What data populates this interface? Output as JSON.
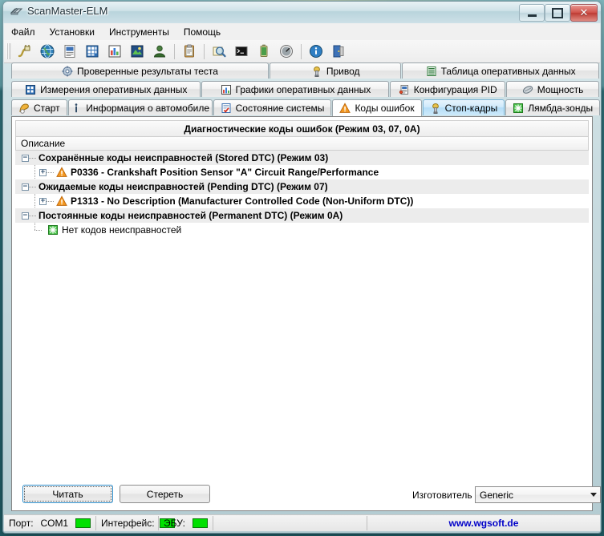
{
  "window": {
    "title": "ScanMaster-ELM",
    "icon": "chip-icon",
    "buttons": {
      "minimize": "minimize-icon",
      "maximize": "maximize-icon",
      "close": "✕"
    }
  },
  "menu": {
    "items": [
      {
        "label": "Файл",
        "name": "menu-file"
      },
      {
        "label": "Установки",
        "name": "menu-settings"
      },
      {
        "label": "Инструменты",
        "name": "menu-tools"
      },
      {
        "label": "Помощь",
        "name": "menu-help"
      }
    ]
  },
  "toolbar": {
    "buttons": [
      {
        "name": "connect-icon"
      },
      {
        "name": "globe-icon"
      },
      {
        "name": "report-icon"
      },
      {
        "name": "grid-icon"
      },
      {
        "name": "chart-icon"
      },
      {
        "name": "image-icon"
      },
      {
        "name": "user-icon"
      },
      {
        "name": "clipboard-icon"
      },
      {
        "name": "search-icon"
      },
      {
        "name": "terminal-icon"
      },
      {
        "name": "battery-icon"
      },
      {
        "name": "gauge-icon"
      },
      {
        "name": "info-icon"
      },
      {
        "name": "exit-icon"
      }
    ]
  },
  "tabs": {
    "row1": [
      {
        "label": "Проверенные результаты теста",
        "icon": "gear-icon",
        "selected": false
      },
      {
        "label": "Привод",
        "icon": "actuator-icon",
        "selected": false
      },
      {
        "label": "Таблица оперативных данных",
        "icon": "table-icon",
        "selected": false
      }
    ],
    "row2": [
      {
        "label": "Измерения оперативных данных",
        "icon": "measurements-icon",
        "selected": false
      },
      {
        "label": "Графики оперативных данных",
        "icon": "graph-icon",
        "selected": false
      },
      {
        "label": "Конфигурация PID",
        "icon": "pid-config-icon",
        "selected": false
      },
      {
        "label": "Мощность",
        "icon": "power-icon",
        "selected": false
      }
    ],
    "row3": [
      {
        "label": "Старт",
        "icon": "start-icon",
        "selected": false
      },
      {
        "label": "Информация о автомобиле",
        "icon": "vehicle-info-icon",
        "selected": false
      },
      {
        "label": "Состояние системы",
        "icon": "system-status-icon",
        "selected": false
      },
      {
        "label": "Коды ошибок",
        "icon": "warning-icon",
        "selected": true
      },
      {
        "label": "Стоп-кадры",
        "icon": "freeze-frame-icon",
        "selected": false,
        "hover": true
      },
      {
        "label": "Лямбда-зонды",
        "icon": "lambda-icon",
        "selected": false
      }
    ]
  },
  "panel": {
    "header": "Диагностические коды ошибок (Режим 03, 07, 0A)",
    "column_header": "Описание"
  },
  "tree": {
    "rows": [
      {
        "level": 0,
        "expander": "−",
        "icon": null,
        "label": "Сохранённые коды неисправностей (Stored DTC) (Режим 03)"
      },
      {
        "level": 1,
        "expander": "+",
        "icon": "warning-icon",
        "label": "P0336 - Crankshaft Position Sensor \"A\" Circuit Range/Performance"
      },
      {
        "level": 0,
        "expander": "−",
        "icon": null,
        "label": "Ожидаемые коды неисправностей (Pending DTC) (Режим 07)"
      },
      {
        "level": 1,
        "expander": "+",
        "icon": "warning-icon",
        "label": "P1313 - No Description (Manufacturer Controlled Code (Non-Uniform DTC))"
      },
      {
        "level": 0,
        "expander": "−",
        "icon": null,
        "label": "Постоянные коды неисправностей (Permanent DTC) (Режим 0A)"
      },
      {
        "level": 1,
        "expander": null,
        "icon": "ok-icon",
        "label": "Нет кодов неисправностей"
      }
    ]
  },
  "actions": {
    "read_label": "Читать",
    "erase_label": "Стереть",
    "manufacturer_label": "Изготовитель",
    "manufacturer_value": "Generic",
    "manufacturer_options": [
      "Generic"
    ]
  },
  "statusbar": {
    "port_label": "Порт:",
    "port_value": "COM1",
    "port_led": "#00e000",
    "interface_label": "Интерфейс:",
    "interface_led": "#00e000",
    "ecu_label": "ЭБУ:",
    "ecu_led": "#00e000",
    "link": "www.wgsoft.de"
  },
  "colors": {
    "accent": "#2a8bc8",
    "warning": "#f08a1e",
    "ok": "#33cc33",
    "link": "#0000c8",
    "titlebar": "#cfe2e8"
  }
}
